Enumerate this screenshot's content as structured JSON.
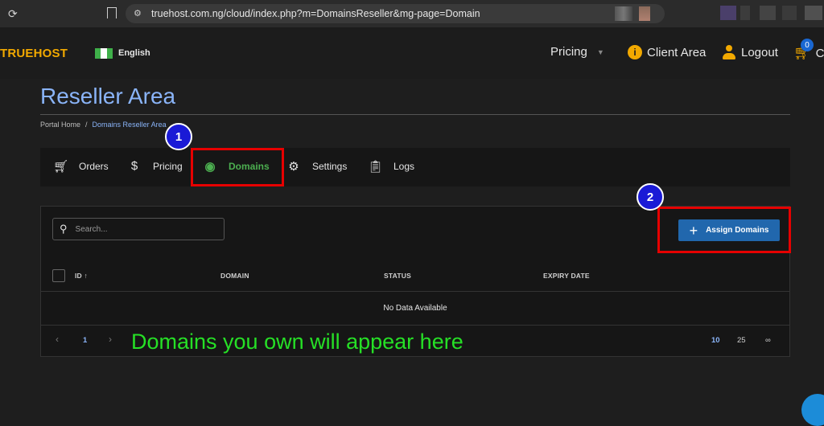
{
  "browser": {
    "url": "truehost.com.ng/cloud/index.php?m=DomainsReseller&mg-page=Domain"
  },
  "header": {
    "logo": "TRUEHOST",
    "language": "English",
    "nav": {
      "pricing": "Pricing",
      "client_area": "Client Area",
      "logout": "Logout",
      "cart_count": "0",
      "cart_label": "C"
    }
  },
  "page": {
    "title": "Reseller Area",
    "breadcrumb": [
      "Portal Home",
      "/",
      "Domains Reseller Area"
    ]
  },
  "tabs": [
    {
      "label": "Orders",
      "icon": "cart-icon"
    },
    {
      "label": "Pricing",
      "icon": "dollar-icon"
    },
    {
      "label": "Domains",
      "icon": "globe-icon",
      "active": true
    },
    {
      "label": "Settings",
      "icon": "gear-icon"
    },
    {
      "label": "Logs",
      "icon": "clipboard-icon"
    }
  ],
  "annotations": {
    "marker1": "1",
    "marker2": "2",
    "note": "Domains you own will appear here"
  },
  "table": {
    "search_placeholder": "Search...",
    "assign_button": "Assign Domains",
    "columns": [
      "ID ↑",
      "DOMAIN",
      "STATUS",
      "EXPIRY DATE"
    ],
    "empty_message": "No Data Available",
    "pager": {
      "prev": "‹",
      "current_page": "1",
      "next": "›",
      "page_sizes": [
        "10",
        "25",
        "∞"
      ]
    }
  },
  "colors": {
    "accent": "#f2a900",
    "link": "#8ab4f8",
    "active_tab": "#4caf50",
    "button": "#2167ad",
    "highlight": "#e60000",
    "note": "#26e026"
  }
}
